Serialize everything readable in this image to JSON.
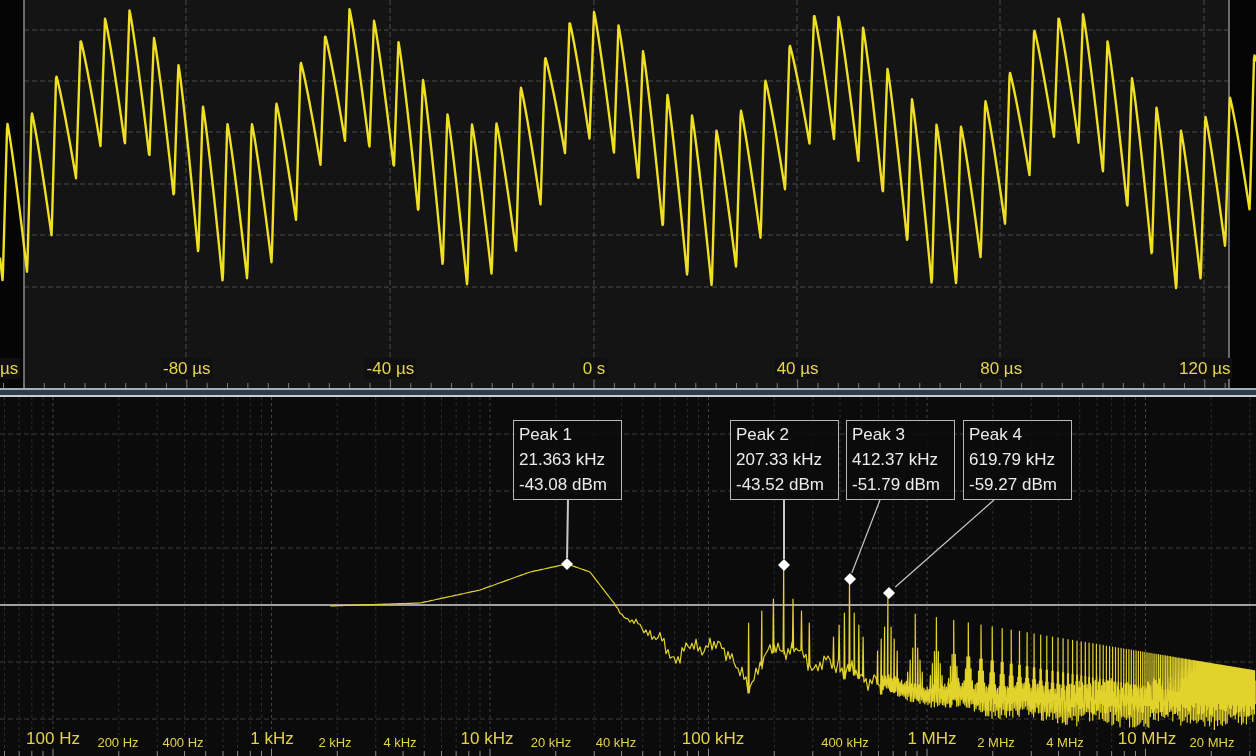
{
  "waveform": {
    "time_labels": [
      "µs",
      "-80 µs",
      "-40 µs",
      "0 s",
      "40 µs",
      "80 µs",
      "120 µs"
    ]
  },
  "spectrum": {
    "peaks": [
      {
        "name": "Peak 1",
        "frequency": "21.363 kHz",
        "amplitude": "-43.08 dBm"
      },
      {
        "name": "Peak 2",
        "frequency": "207.33 kHz",
        "amplitude": "-43.52 dBm"
      },
      {
        "name": "Peak 3",
        "frequency": "412.37 kHz",
        "amplitude": "-51.79 dBm"
      },
      {
        "name": "Peak 4",
        "frequency": "619.79 kHz",
        "amplitude": "-59.27 dBm"
      }
    ],
    "frequency_labels": [
      {
        "label": "100 Hz",
        "kind": "major"
      },
      {
        "label": "200 Hz",
        "kind": "minor"
      },
      {
        "label": "400 Hz",
        "kind": "minor"
      },
      {
        "label": "1 kHz",
        "kind": "major"
      },
      {
        "label": "2 kHz",
        "kind": "minor"
      },
      {
        "label": "4 kHz",
        "kind": "minor"
      },
      {
        "label": "10 kHz",
        "kind": "major"
      },
      {
        "label": "20 kHz",
        "kind": "minor"
      },
      {
        "label": "40 kHz",
        "kind": "minor"
      },
      {
        "label": "100 kHz",
        "kind": "major"
      },
      {
        "label": "400 kHz",
        "kind": "minor"
      },
      {
        "label": "1 MHz",
        "kind": "major"
      },
      {
        "label": "2 MHz",
        "kind": "minor"
      },
      {
        "label": "4 MHz",
        "kind": "minor"
      },
      {
        "label": "10 MHz",
        "kind": "major"
      },
      {
        "label": "20 MHz",
        "kind": "minor"
      }
    ]
  }
}
